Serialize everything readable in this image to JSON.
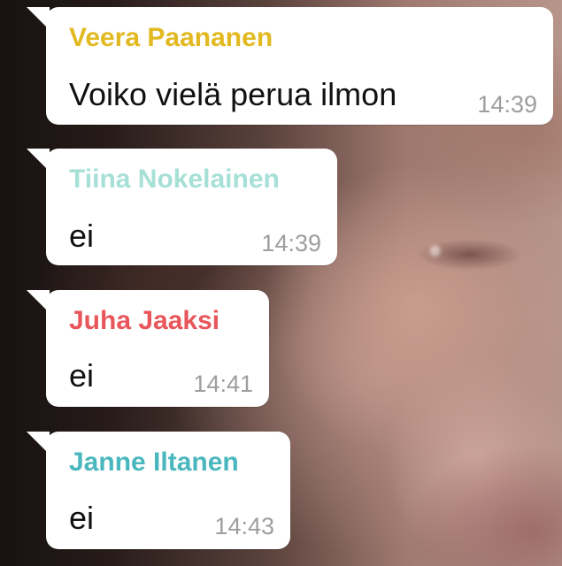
{
  "colors": {
    "bubble_bg": "#ffffff",
    "message_text": "#111111",
    "timestamp": "#9e9e9e"
  },
  "messages": [
    {
      "sender": "Veera Paananen",
      "sender_color": "#e2b921",
      "text": "Voiko vielä perua ilmon",
      "time": "14:39"
    },
    {
      "sender": "Tiina Nokelainen",
      "sender_color": "#a6e0d6",
      "text": "ei",
      "time": "14:39"
    },
    {
      "sender": "Juha Jaaksi",
      "sender_color": "#e8565b",
      "text": "ei",
      "time": "14:41"
    },
    {
      "sender": "Janne Iltanen",
      "sender_color": "#49b7bd",
      "text": "ei",
      "time": "14:43"
    }
  ]
}
